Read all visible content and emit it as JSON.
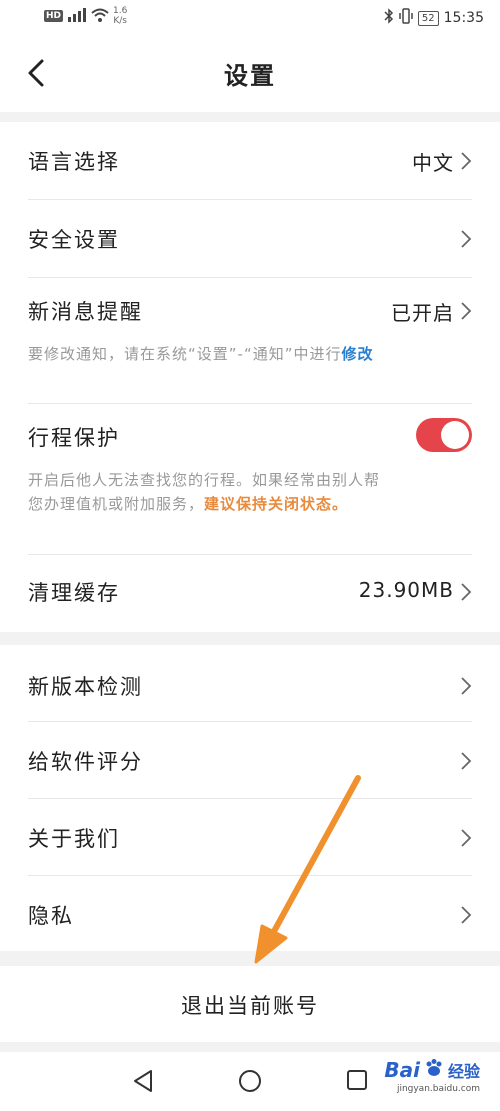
{
  "status_bar": {
    "hd": "HD",
    "signal": "⁵ᴳ",
    "speed_value": "1.6",
    "speed_unit": "K/s",
    "battery": "52",
    "time": "15:35"
  },
  "nav": {
    "title": "设置"
  },
  "settings": {
    "language": {
      "label": "语言选择",
      "value": "中文"
    },
    "security": {
      "label": "安全设置"
    },
    "notification": {
      "label": "新消息提醒",
      "value": "已开启",
      "note_prefix": "要修改通知，请在系统“设置”-“通知”中进行",
      "note_link": "修改"
    },
    "trip_protect": {
      "label": "行程保护",
      "enabled": true,
      "note_prefix": "开启后他人无法查找您的行程。如果经常由别人帮您办理值机或附加服务，",
      "note_warn": "建议保持关闭状态。"
    },
    "cache": {
      "label": "清理缓存",
      "value": "23.90MB"
    }
  },
  "about": {
    "version": {
      "label": "新版本检测"
    },
    "rate": {
      "label": "给软件评分"
    },
    "about_us": {
      "label": "关于我们"
    },
    "privacy": {
      "label": "隐私"
    }
  },
  "logout": {
    "label": "退出当前账号"
  },
  "watermark": {
    "brand": "Bai",
    "brand_cn": "经验",
    "url": "jingyan.baidu.com"
  },
  "colors": {
    "toggle_on": "#e5454a",
    "link": "#2a7fd1",
    "warn": "#e98a3c",
    "arrow": "#f0912e"
  }
}
